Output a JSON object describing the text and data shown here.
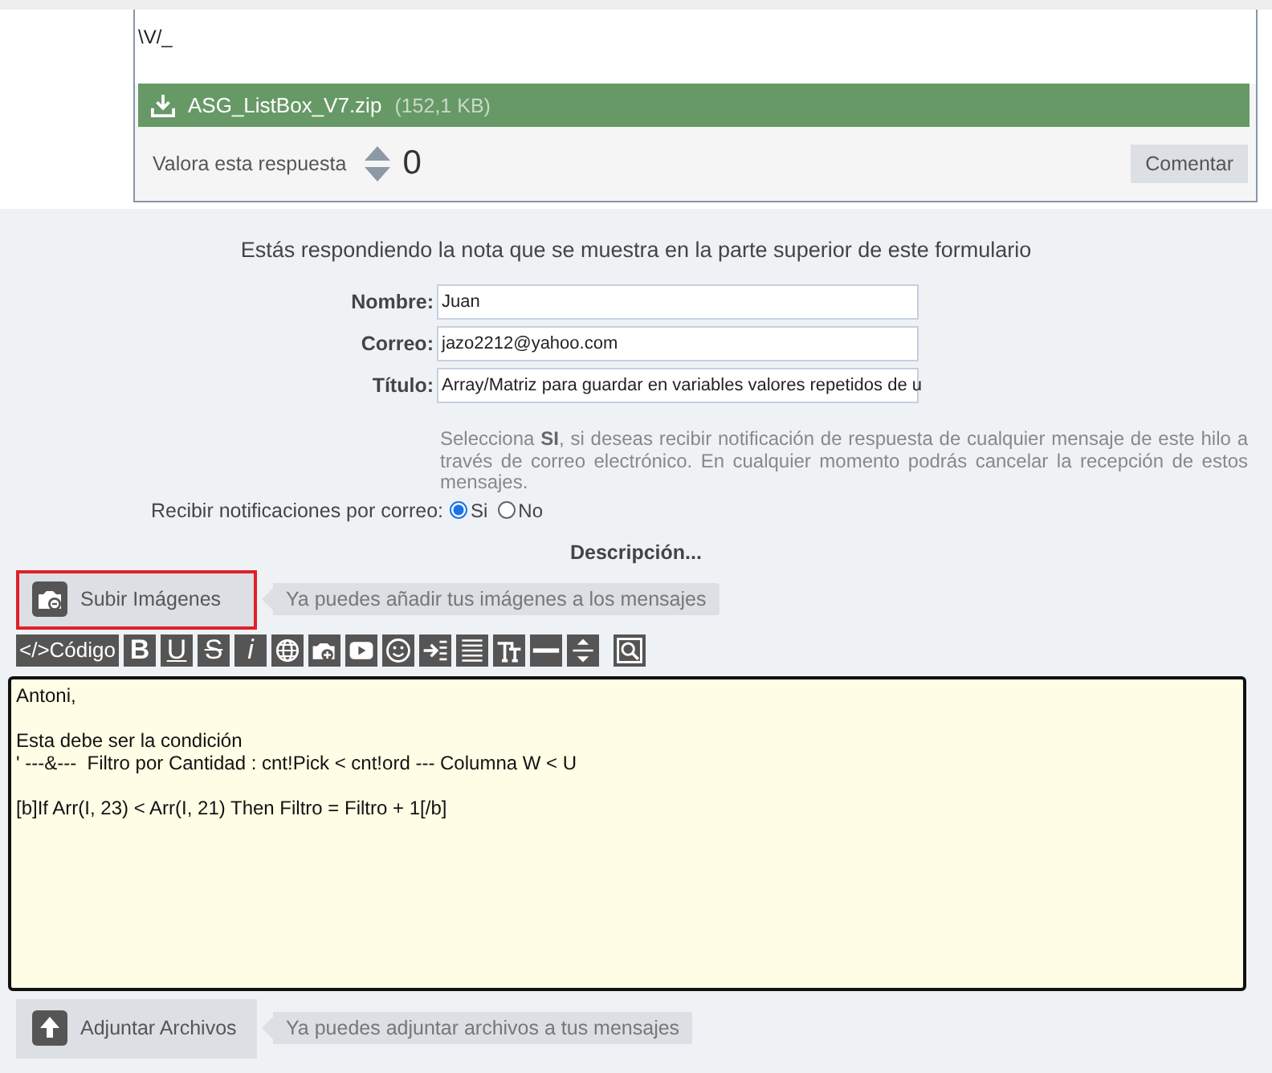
{
  "post": {
    "signature": "\\V/_",
    "attachment": {
      "name": "ASG_ListBox_V7.zip",
      "size": "(152,1 KB)"
    },
    "rating": {
      "label": "Valora esta respuesta",
      "score": "0"
    },
    "comment_button": "Comentar"
  },
  "reply_form": {
    "heading": "Estás respondiendo la nota que se muestra en la parte superior de este formulario",
    "fields": [
      {
        "label": "Nombre:",
        "value": "Juan"
      },
      {
        "label": "Correo:",
        "value": "jazo2212@yahoo.com"
      },
      {
        "label": "Título:",
        "value": "Array/Matriz para guardar en variables valores repetidos de u"
      }
    ],
    "notification_note": "Selecciona **SI**, si deseas recibir notificación de respuesta de cualquier mensaje de este hilo a través de correo electrónico. En cualquier momento podrás cancelar la recepción de estos mensajes.",
    "notifications": {
      "label": "Recibir notificaciones por correo:",
      "options": [
        {
          "label": "Si",
          "selected": true
        },
        {
          "label": "No",
          "selected": false
        }
      ]
    },
    "description_label": "Descripción...",
    "upload_images": {
      "label": "Subir Imágenes",
      "highlighted": true,
      "hint": "Ya puedes añadir tus imágenes a los mensajes"
    },
    "toolbar": [
      {
        "kind": "code",
        "label": "</>Código"
      },
      {
        "kind": "letter",
        "label": "B"
      },
      {
        "kind": "letter",
        "label": "U"
      },
      {
        "kind": "letter",
        "label": "S"
      },
      {
        "kind": "letter",
        "label": "i"
      },
      {
        "kind": "icon"
      },
      {
        "kind": "icon"
      },
      {
        "kind": "icon"
      },
      {
        "kind": "icon"
      },
      {
        "kind": "icon"
      },
      {
        "kind": "icon"
      },
      {
        "kind": "icon"
      },
      {
        "kind": "icon"
      },
      {
        "kind": "icon"
      },
      {
        "kind": "icon"
      }
    ],
    "message": "Antoni,\n\nEsta debe ser la condición\n' ---&---  Filtro por Cantidad : cnt!Pick < cnt!ord --- Columna W < U\n\n[b]If Arr(I, 23) < Arr(I, 21) Then Filtro = Filtro + 1[/b]",
    "attach_files": {
      "label": "Adjuntar Archivos",
      "hint": "Ya puedes adjuntar archivos a tus mensajes"
    }
  }
}
